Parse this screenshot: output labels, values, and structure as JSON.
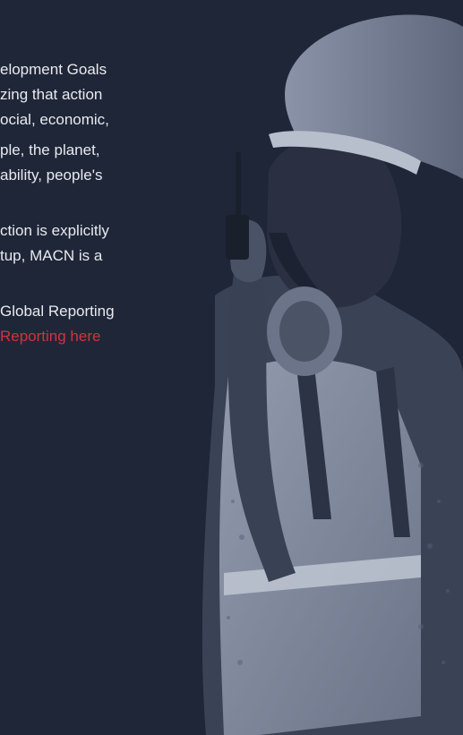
{
  "paragraphs": [
    {
      "lines": [
        "elopment  Goals",
        "zing that action",
        "ocial, economic,"
      ]
    },
    {
      "lines": [
        "ple,  the  planet,",
        "ability, people's"
      ]
    },
    {
      "lines": [
        "ction is explicitly",
        "tup, MACN is a"
      ]
    },
    {
      "lines": [
        "Global Reporting"
      ],
      "link_text": "Reporting here"
    }
  ],
  "colors": {
    "background": "#1f2638",
    "text": "#e8eaef",
    "link": "#d0343c"
  }
}
